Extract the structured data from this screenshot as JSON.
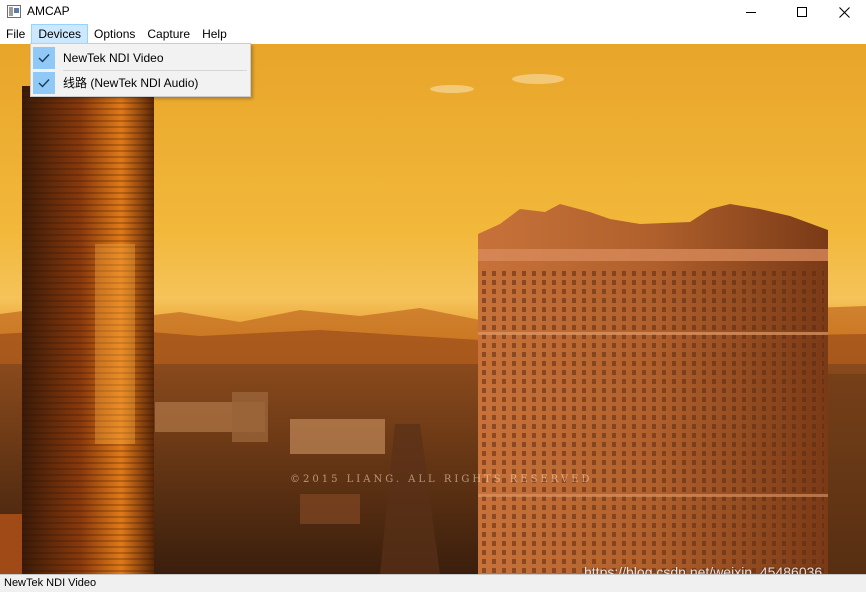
{
  "window": {
    "title": "AMCAP",
    "icon": "amcap-app-icon",
    "controls": [
      "minimize-icon",
      "maximize-icon",
      "close-icon"
    ]
  },
  "menubar": {
    "items": [
      {
        "label": "File"
      },
      {
        "label": "Devices",
        "active": true
      },
      {
        "label": "Options"
      },
      {
        "label": "Capture"
      },
      {
        "label": "Help"
      }
    ]
  },
  "devices_menu": {
    "items": [
      {
        "label": "NewTek NDI Video",
        "checked": true,
        "icon": "checkmark-icon"
      },
      {
        "label": "线路 (NewTek NDI Audio)",
        "checked": true,
        "icon": "checkmark-icon"
      }
    ]
  },
  "preview": {
    "overlay_text": "©2015 LIANG. ALL RIGHTS RESERVED",
    "source_watermark": "https://blog.csdn.net/weixin_45486036"
  },
  "statusbar": {
    "text": "NewTek NDI Video"
  },
  "colors": {
    "menu_highlight": "#cce8ff",
    "check_box": "#90c8f6",
    "sky_top": "#e8a52a",
    "sky_horizon": "#f5c35a"
  }
}
